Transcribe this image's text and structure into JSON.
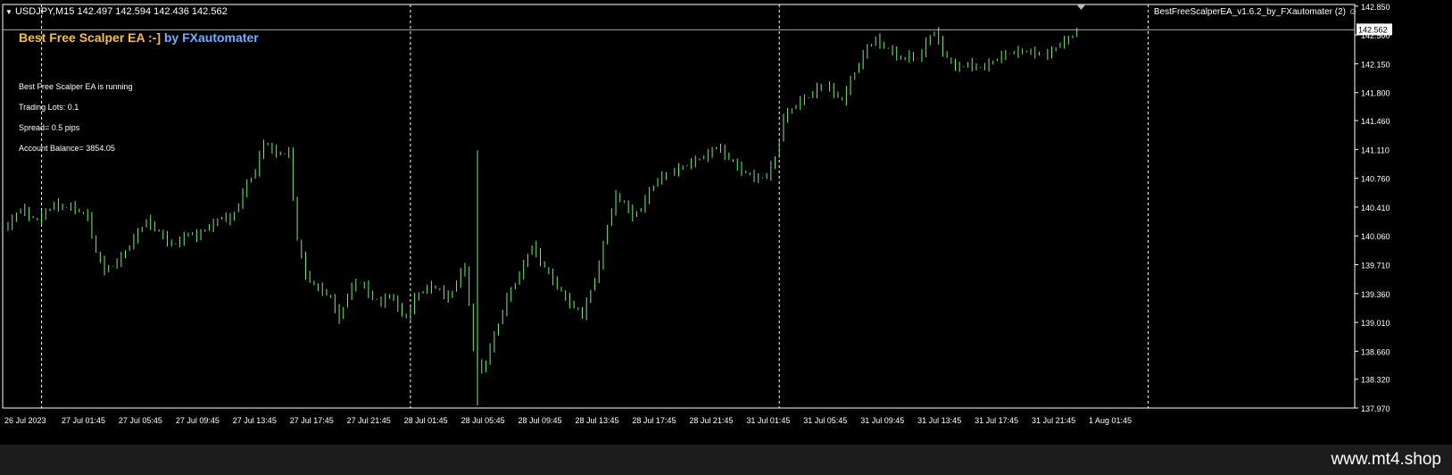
{
  "header": {
    "symbol_line": "USDJPY,M15  142.497 142.594 142.436 142.562",
    "ea_title_part1": "Best Free Scalper EA :-]",
    "ea_title_part2": " by FXautomater",
    "ea_name": "BestFreeScalperEA_v1.6.2_by_FXautomater (2)"
  },
  "info": {
    "status": "Best Free Scalper EA is running",
    "lots": "Trading Lots:  0.1",
    "spread": "Spread= 0.5 pips",
    "balance": "Account Balance= 3854.05"
  },
  "footer": {
    "watermark": "www.mt4.shop"
  },
  "colors": {
    "candle": "#6cf26c",
    "background": "#000000",
    "grid": "#ffffff"
  },
  "chart_data": {
    "type": "line",
    "title": "USDJPY,M15",
    "current_price": 142.562,
    "current_price_label": "142.562",
    "ylim": [
      137.97,
      142.87
    ],
    "y_ticks": [
      "142.850",
      "142.500",
      "142.150",
      "141.800",
      "141.460",
      "141.110",
      "140.760",
      "140.410",
      "140.060",
      "139.710",
      "139.360",
      "139.010",
      "138.660",
      "138.320",
      "137.970"
    ],
    "x_ticks": [
      "26 Jul 2023",
      "27 Jul 01:45",
      "27 Jul 05:45",
      "27 Jul 09:45",
      "27 Jul 13:45",
      "27 Jul 17:45",
      "27 Jul 21:45",
      "28 Jul 01:45",
      "28 Jul 05:45",
      "28 Jul 09:45",
      "28 Jul 13:45",
      "28 Jul 17:45",
      "28 Jul 21:45",
      "31 Jul 01:45",
      "31 Jul 05:45",
      "31 Jul 09:45",
      "31 Jul 13:45",
      "31 Jul 17:45",
      "31 Jul 21:45",
      "1 Aug 01:45"
    ],
    "day_separators": [
      "27 Jul",
      "28 Jul",
      "31 Jul",
      "1 Aug"
    ],
    "series": [
      {
        "values": [
          [
            0,
            140.15
          ],
          [
            2,
            140.25
          ],
          [
            4,
            140.4
          ],
          [
            6,
            140.3
          ],
          [
            8,
            140.25
          ],
          [
            10,
            140.35
          ],
          [
            12,
            140.45
          ],
          [
            14,
            140.4
          ],
          [
            16,
            140.42
          ],
          [
            18,
            140.35
          ],
          [
            20,
            140.3
          ],
          [
            22,
            139.85
          ],
          [
            24,
            139.65
          ],
          [
            26,
            139.7
          ],
          [
            28,
            139.8
          ],
          [
            30,
            139.95
          ],
          [
            32,
            140.1
          ],
          [
            34,
            140.25
          ],
          [
            36,
            140.15
          ],
          [
            38,
            140.05
          ],
          [
            40,
            139.95
          ],
          [
            42,
            140.0
          ],
          [
            44,
            140.1
          ],
          [
            46,
            140.05
          ],
          [
            48,
            140.15
          ],
          [
            50,
            140.2
          ],
          [
            52,
            140.3
          ],
          [
            54,
            140.25
          ],
          [
            56,
            140.45
          ],
          [
            58,
            140.7
          ],
          [
            60,
            140.85
          ],
          [
            62,
            141.2
          ],
          [
            64,
            141.1
          ],
          [
            66,
            141.05
          ],
          [
            68,
            141.08
          ],
          [
            70,
            140.0
          ],
          [
            72,
            139.6
          ],
          [
            74,
            139.45
          ],
          [
            76,
            139.4
          ],
          [
            78,
            139.3
          ],
          [
            80,
            139.05
          ],
          [
            82,
            139.35
          ],
          [
            84,
            139.5
          ],
          [
            86,
            139.45
          ],
          [
            88,
            139.3
          ],
          [
            90,
            139.25
          ],
          [
            92,
            139.35
          ],
          [
            94,
            139.2
          ],
          [
            96,
            139.05
          ],
          [
            98,
            139.3
          ],
          [
            100,
            139.4
          ],
          [
            102,
            139.45
          ],
          [
            104,
            139.4
          ],
          [
            106,
            139.3
          ],
          [
            108,
            139.5
          ],
          [
            110,
            139.7
          ],
          [
            112,
            138.7
          ],
          [
            114,
            138.4
          ],
          [
            116,
            138.7
          ],
          [
            118,
            139.0
          ],
          [
            120,
            139.3
          ],
          [
            122,
            139.5
          ],
          [
            124,
            139.7
          ],
          [
            126,
            139.95
          ],
          [
            128,
            139.75
          ],
          [
            130,
            139.6
          ],
          [
            132,
            139.45
          ],
          [
            134,
            139.3
          ],
          [
            136,
            139.2
          ],
          [
            138,
            139.1
          ],
          [
            140,
            139.4
          ],
          [
            142,
            139.7
          ],
          [
            144,
            140.2
          ],
          [
            146,
            140.55
          ],
          [
            148,
            140.45
          ],
          [
            150,
            140.3
          ],
          [
            152,
            140.4
          ],
          [
            154,
            140.6
          ],
          [
            156,
            140.75
          ],
          [
            158,
            140.8
          ],
          [
            160,
            140.85
          ],
          [
            162,
            140.9
          ],
          [
            164,
            140.95
          ],
          [
            166,
            141.0
          ],
          [
            168,
            141.05
          ],
          [
            170,
            141.15
          ],
          [
            172,
            141.05
          ],
          [
            174,
            140.95
          ],
          [
            176,
            140.85
          ],
          [
            178,
            140.8
          ],
          [
            180,
            140.75
          ],
          [
            182,
            140.8
          ],
          [
            184,
            141.0
          ],
          [
            186,
            141.5
          ],
          [
            188,
            141.6
          ],
          [
            190,
            141.7
          ],
          [
            192,
            141.75
          ],
          [
            194,
            141.85
          ],
          [
            196,
            141.9
          ],
          [
            198,
            141.8
          ],
          [
            200,
            141.7
          ],
          [
            202,
            141.95
          ],
          [
            204,
            142.15
          ],
          [
            206,
            142.35
          ],
          [
            208,
            142.45
          ],
          [
            210,
            142.35
          ],
          [
            212,
            142.3
          ],
          [
            214,
            142.2
          ],
          [
            216,
            142.25
          ],
          [
            218,
            142.2
          ],
          [
            220,
            142.4
          ],
          [
            222,
            142.55
          ],
          [
            224,
            142.3
          ],
          [
            226,
            142.15
          ],
          [
            228,
            142.1
          ],
          [
            230,
            142.15
          ],
          [
            232,
            142.1
          ],
          [
            234,
            142.12
          ],
          [
            236,
            142.18
          ],
          [
            238,
            142.25
          ],
          [
            240,
            142.28
          ],
          [
            242,
            142.3
          ],
          [
            244,
            142.3
          ],
          [
            246,
            142.28
          ],
          [
            248,
            142.25
          ],
          [
            250,
            142.3
          ],
          [
            252,
            142.4
          ],
          [
            254,
            142.45
          ],
          [
            256,
            142.56
          ]
        ]
      }
    ]
  }
}
